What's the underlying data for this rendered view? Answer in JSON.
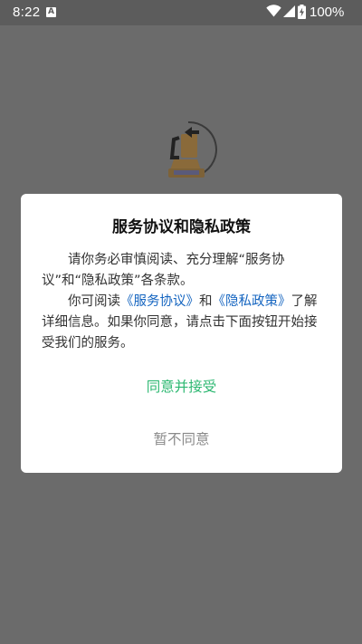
{
  "status_bar": {
    "time": "8:22",
    "notification_letter": "A",
    "battery_percent": "100%",
    "icons": [
      "notification-icon",
      "wifi-icon",
      "signal-icon",
      "battery-charging-icon"
    ]
  },
  "dialog": {
    "title": "服务协议和隐私政策",
    "paragraph1": "请你务必审慎阅读、充分理解“服务协议”和“隐私政策”各条款。",
    "paragraph2_prefix": "你可阅读",
    "service_link": "《服务协议》",
    "and_text": "和",
    "privacy_link": "《隐私政策》",
    "paragraph2_suffix": "了解详细信息。如果你同意，请点击下面按钮开始接受我们的服务。",
    "accept_label": "同意并接受",
    "decline_label": "暂不同意"
  },
  "colors": {
    "accept": "#2eb872",
    "link": "#1565c0",
    "decline": "#8a8a8a",
    "overlay_bg": "#6b6b6b"
  }
}
